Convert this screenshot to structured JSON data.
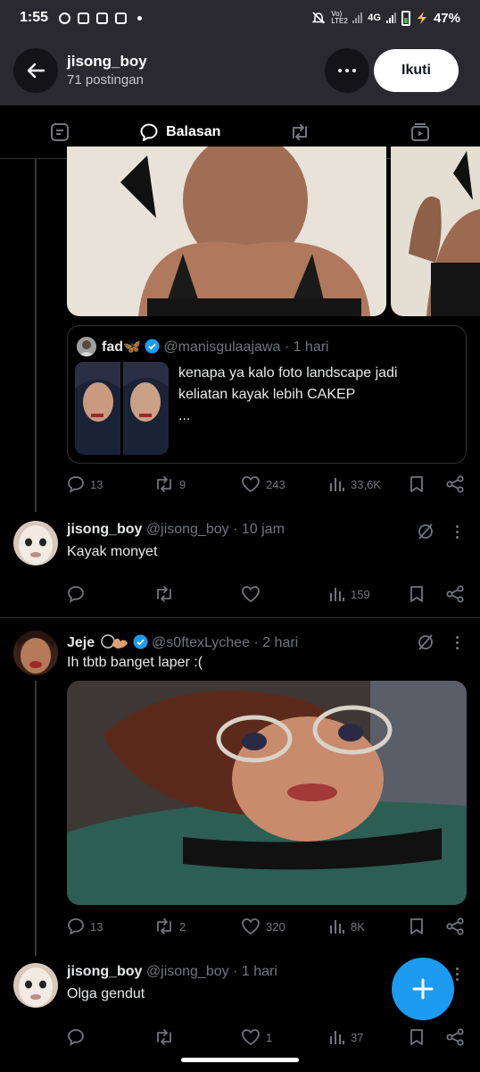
{
  "status_bar": {
    "time": "1:55",
    "network_volte": "Vo) LTE2",
    "network_type": "4G",
    "battery": "47%"
  },
  "header": {
    "title": "jisong_boy",
    "subtitle": "71 postingan",
    "follow_label": "Ikuti"
  },
  "tabs": [
    {
      "id": "posts",
      "icon": "post-icon",
      "label": ""
    },
    {
      "id": "replies",
      "icon": "reply-bubble-icon",
      "label": "Balasan",
      "active": true
    },
    {
      "id": "reposts",
      "icon": "repost-icon",
      "label": ""
    },
    {
      "id": "media",
      "icon": "media-icon",
      "label": ""
    }
  ],
  "post1": {
    "quote": {
      "name": "fad🦋",
      "handle": "@manisgulaajawa",
      "time": "· 1 hari",
      "text_lines": [
        "kenapa ya kalo foto landscape jadi",
        "keliatan kayak lebih CAKEP",
        "..."
      ]
    },
    "stats": {
      "replies": "13",
      "reposts": "9",
      "likes": "243",
      "views": "33,6K"
    }
  },
  "post2": {
    "name": "jisong_boy",
    "handle": "@jisong_boy",
    "time": "· 10 jam",
    "text": "Kayak monyet",
    "stats": {
      "replies": "",
      "reposts": "",
      "likes": "",
      "views": "159"
    }
  },
  "post3": {
    "name": "Jeje",
    "handle": "@s0ftexLychee",
    "time": "· 2 hari",
    "text": "Ih tbtb banget laper :(",
    "stats": {
      "replies": "13",
      "reposts": "2",
      "likes": "320",
      "views": "8K"
    }
  },
  "post4": {
    "name": "jisong_boy",
    "handle": "@jisong_boy",
    "time": "· 1 hari",
    "text": "Olga gendut",
    "stats": {
      "replies": "",
      "reposts": "",
      "likes": "1",
      "views": "37"
    }
  },
  "colors": {
    "accent": "#1d9bf0",
    "text_secondary": "#71767b",
    "divider": "#2f3336"
  }
}
